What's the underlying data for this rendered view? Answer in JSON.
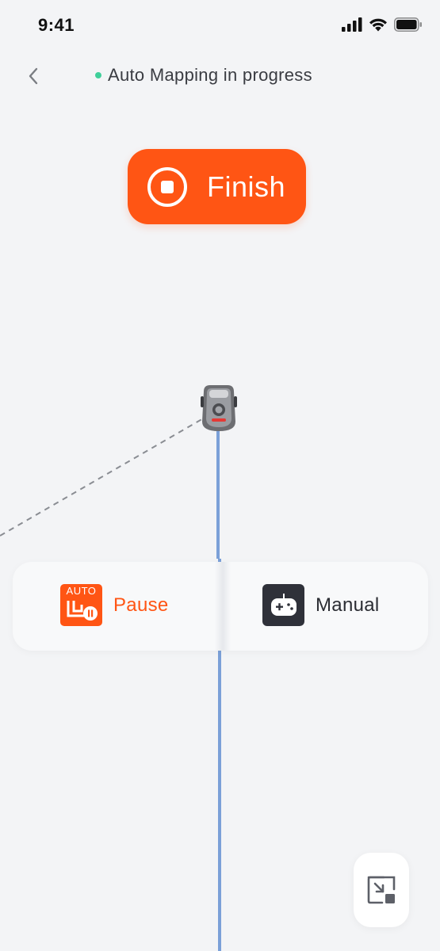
{
  "status_bar": {
    "time": "9:41"
  },
  "header": {
    "title": "Auto Mapping in progress",
    "status_dot_color": "#3fcf9a",
    "back_icon": "chevron-left-icon"
  },
  "finish_button": {
    "label": "Finish",
    "icon": "stop-circle-icon",
    "color": "#ff5514"
  },
  "map": {
    "path_color": "#7ba0d8",
    "guide_line": "dashed",
    "robot_icon": "mower-robot-icon"
  },
  "mode_panel": {
    "pause": {
      "label": "Pause",
      "badge_text": "AUTO",
      "icon": "auto-pause-icon",
      "color": "#ff5514"
    },
    "manual": {
      "label": "Manual",
      "icon": "gamepad-icon"
    }
  },
  "zoom_button": {
    "icon": "minimize-map-icon"
  }
}
